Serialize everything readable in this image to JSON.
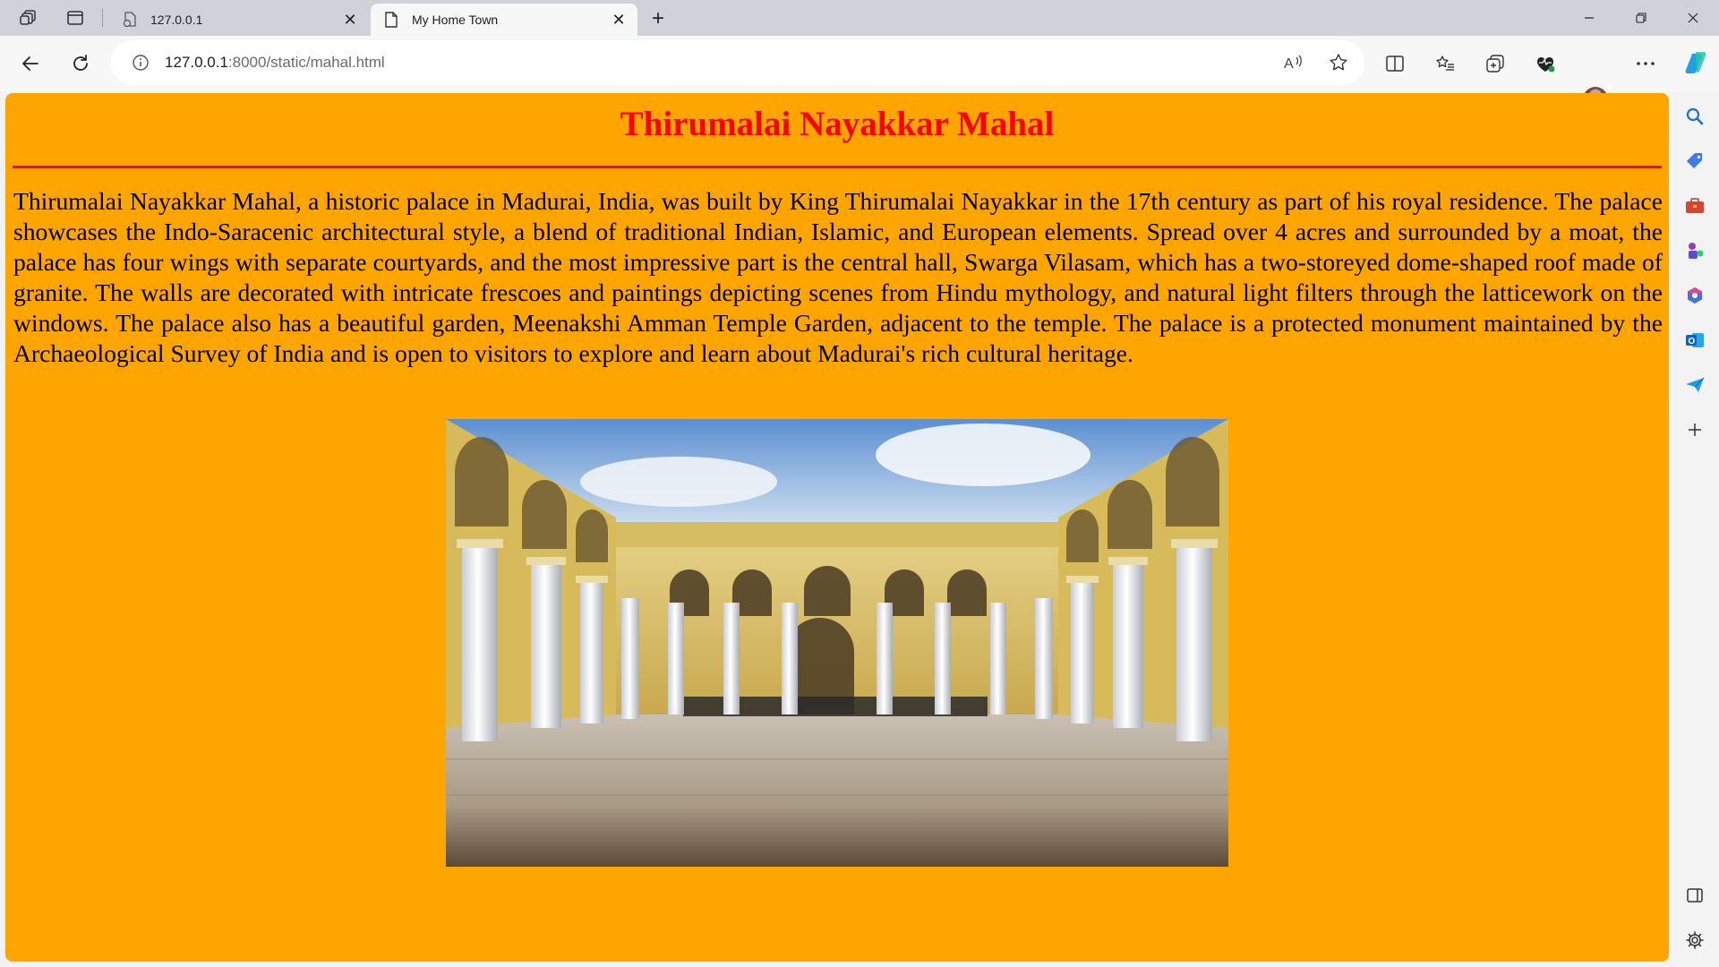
{
  "browser": {
    "tabs": [
      {
        "label": "127.0.0.1",
        "active": false
      },
      {
        "label": "My Home Town",
        "active": true
      }
    ],
    "url_host": "127.0.0.1",
    "url_path": ":8000/static/mahal.html",
    "accent": "#ffa500"
  },
  "page": {
    "title": "Thirumalai Nayakkar Mahal",
    "paragraph": "Thirumalai Nayakkar Mahal, a historic palace in Madurai, India, was built by King Thirumalai Nayakkar in the 17th century as part of his royal residence. The palace showcases the Indo-Saracenic architectural style, a blend of traditional Indian, Islamic, and European elements. Spread over 4 acres and surrounded by a moat, the palace has four wings with separate courtyards, and the most impressive part is the central hall, Swarga Vilasam, which has a two-storeyed dome-shaped roof made of granite. The walls are decorated with intricate frescoes and paintings depicting scenes from Hindu mythology, and natural light filters through the latticework on the windows. The palace also has a beautiful garden, Meenakshi Amman Temple Garden, adjacent to the temple. The palace is a protected monument maintained by the Archaeological Survey of India and is open to visitors to explore and learn about Madurai's rich cultural heritage.",
    "background_color": "#ffa500",
    "title_color": "#ff0000"
  }
}
